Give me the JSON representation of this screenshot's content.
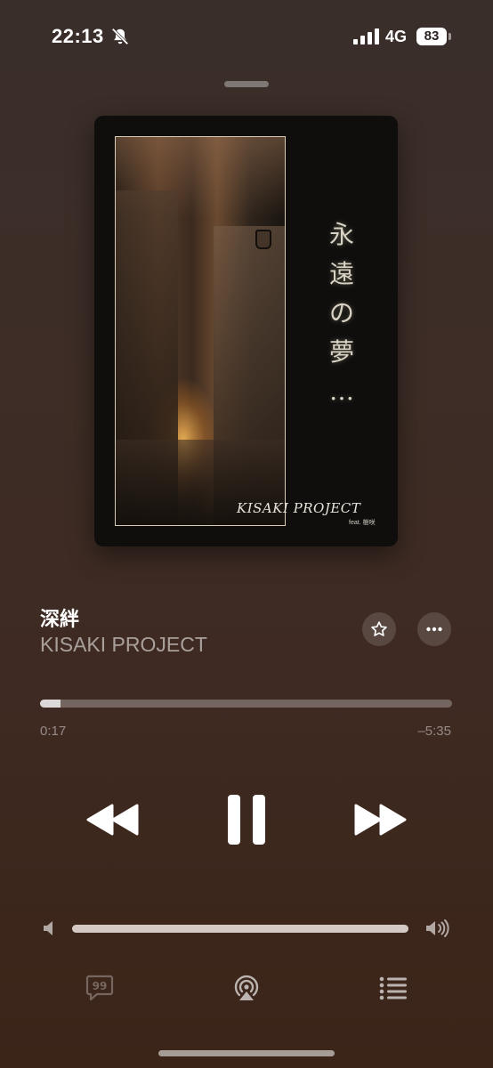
{
  "status": {
    "time": "22:13",
    "network": "4G",
    "battery": "83"
  },
  "artwork": {
    "title_chars": [
      "永",
      "遠",
      "の",
      "夢",
      "…"
    ],
    "brand": "KISAKI PROJECT",
    "brand_sub": "feat. 樹咲"
  },
  "track": {
    "title": "深絆",
    "artist": "KISAKI PROJECT"
  },
  "playback": {
    "elapsed": "0:17",
    "remaining": "–5:35",
    "progress_fraction": 0.05
  },
  "volume": {
    "level_fraction": 1.0
  },
  "icons": {
    "mute": "bell-slash-icon",
    "favorite": "star-icon",
    "more": "ellipsis-icon",
    "rewind": "rewind-icon",
    "pause": "pause-icon",
    "forward": "fast-forward-icon",
    "volume_low": "speaker-icon",
    "volume_high": "speaker-wave-icon",
    "lyrics": "quote-bubble-icon",
    "airplay": "airplay-icon",
    "queue": "list-icon"
  }
}
